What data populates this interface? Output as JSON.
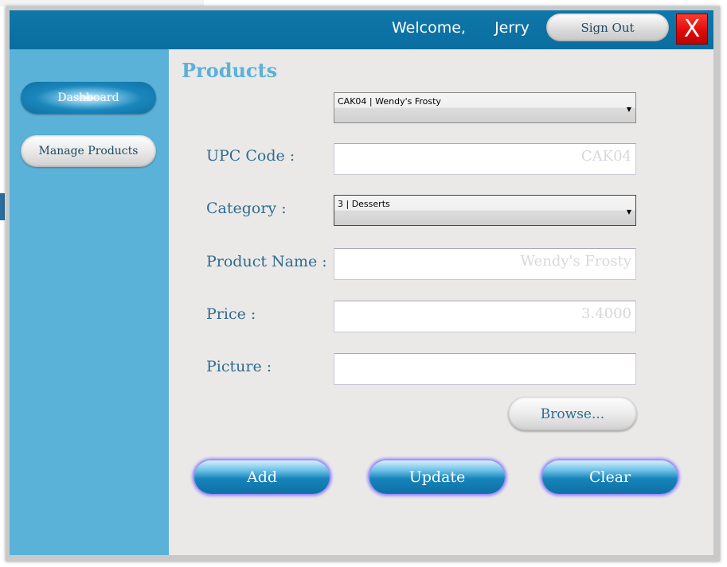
{
  "header": {
    "welcome_text": "Welcome,   Jerry  !",
    "sign_out_label": "Sign Out",
    "close_label": "X"
  },
  "sidebar": {
    "items": [
      {
        "label": "Dashboard"
      },
      {
        "label": "Manage Products"
      }
    ]
  },
  "main": {
    "title": "Products",
    "product_select": {
      "value": "CAK04 | Wendy's Frosty"
    },
    "fields": {
      "upc": {
        "label": "UPC Code :",
        "value": "CAK04"
      },
      "category": {
        "label": "Category :",
        "value": "3 | Desserts"
      },
      "product_name": {
        "label": "Product Name :",
        "value": "Wendy's Frosty"
      },
      "price": {
        "label": "Price :",
        "value": "3.4000"
      },
      "picture": {
        "label": "Picture :",
        "value": ""
      }
    },
    "browse_label": "Browse...",
    "actions": {
      "add": "Add",
      "update": "Update",
      "clear": "Clear"
    }
  },
  "colors": {
    "header_bg": "#0a6d9f",
    "sidebar_bg": "#5ab2d9",
    "content_bg": "#ebe9e8",
    "title": "#5ab2d9",
    "label": "#2e6d8f",
    "close_red": "#e00c0c"
  }
}
